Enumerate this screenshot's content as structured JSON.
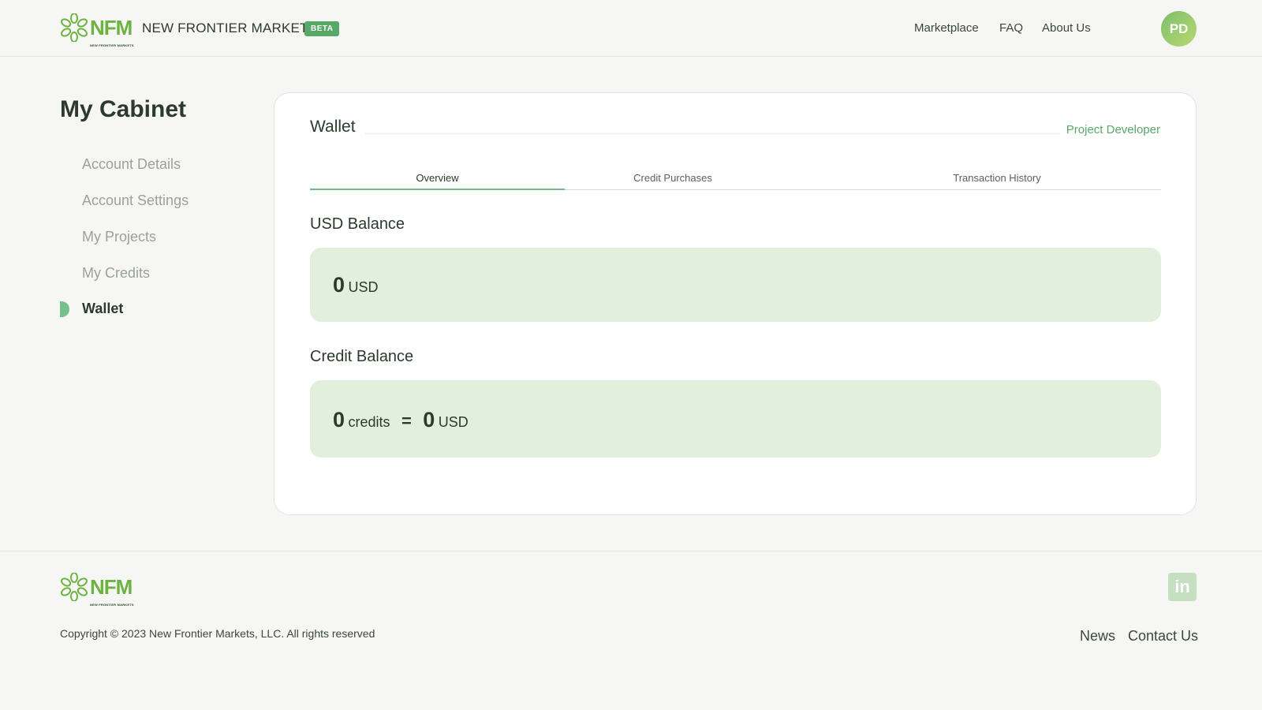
{
  "header": {
    "brand_logo": "NFM",
    "brand_logo_sub": "NEW FRONTIER MARKETS",
    "brand_name": "NEW FRONTIER MARKETS",
    "badge": "BETA",
    "nav": [
      "Marketplace",
      "FAQ",
      "About Us"
    ],
    "avatar_initials": "PD"
  },
  "sidebar": {
    "title": "My Cabinet",
    "items": [
      {
        "label": "Account Details",
        "active": false
      },
      {
        "label": "Account Settings",
        "active": false
      },
      {
        "label": "My Projects",
        "active": false
      },
      {
        "label": "My Credits",
        "active": false
      },
      {
        "label": "Wallet",
        "active": true
      }
    ]
  },
  "wallet": {
    "title": "Wallet",
    "role": "Project Developer",
    "tabs": [
      {
        "label": "Overview",
        "active": true
      },
      {
        "label": "Credit Purchases",
        "active": false
      },
      {
        "label": "Transaction History",
        "active": false
      }
    ],
    "usd_section": {
      "label": "USD Balance",
      "amount": "0",
      "unit": "USD"
    },
    "credit_section": {
      "label": "Credit Balance",
      "credits_amount": "0",
      "credits_unit": "credits",
      "equals": "=",
      "usd_amount": "0",
      "usd_unit": "USD"
    }
  },
  "footer": {
    "logo": "NFM",
    "logo_sub": "NEW FRONTIER MARKETS",
    "copyright": "Copyright © 2023 New Frontier Markets, LLC. All rights reserved",
    "links": [
      "News",
      "Contact Us"
    ],
    "social_icon": "linkedin-icon",
    "social_label": "in"
  },
  "colors": {
    "accent": "#58a868",
    "balance_bg": "#e2efdc",
    "page_bg": "#f6f6f4"
  }
}
